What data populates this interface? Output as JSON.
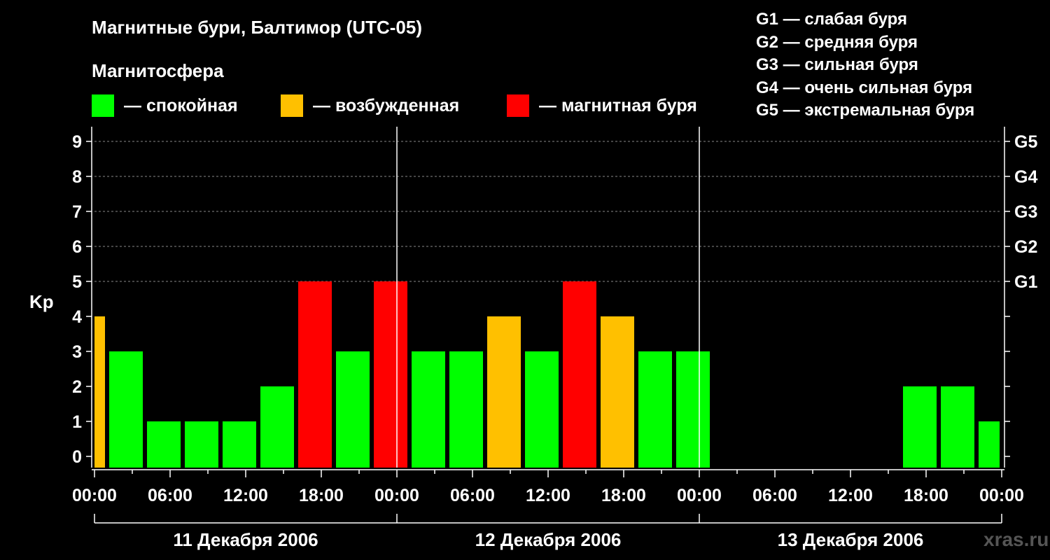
{
  "header": {
    "title": "Магнитные бури, Балтимор (UTC-05)",
    "magnetosphere_label": "Магнитосфера"
  },
  "legend": [
    {
      "label": "— спокойная",
      "color": "#00ff00"
    },
    {
      "label": "— возбужденная",
      "color": "#ffc000"
    },
    {
      "label": "— магнитная буря",
      "color": "#ff0000"
    }
  ],
  "g_scale": [
    "G1 — слабая буря",
    "G2 — средняя буря",
    "G3 — сильная буря",
    "G4 — очень сильная буря",
    "G5 — экстремальная буря"
  ],
  "watermark": "xras.ru",
  "chart_data": {
    "type": "bar",
    "title": "Магнитные бури, Балтимор (UTC-05)",
    "ylabel": "Kp",
    "ylim": [
      0,
      9
    ],
    "yticks": [
      "0",
      "1",
      "2",
      "3",
      "4",
      "5",
      "6",
      "7",
      "8",
      "9"
    ],
    "right_axis_labels": [
      {
        "kp": 5,
        "label": "G1"
      },
      {
        "kp": 6,
        "label": "G2"
      },
      {
        "kp": 7,
        "label": "G3"
      },
      {
        "kp": 8,
        "label": "G4"
      },
      {
        "kp": 9,
        "label": "G5"
      }
    ],
    "xtick_labels": [
      "00:00",
      "06:00",
      "12:00",
      "18:00",
      "00:00",
      "06:00",
      "12:00",
      "18:00",
      "00:00",
      "06:00",
      "12:00",
      "18:00",
      "00:00"
    ],
    "days": [
      "11 Декабря 2006",
      "12 Декабря 2006",
      "13 Декабря 2006"
    ],
    "grid": "horizontal dashed at Kp 5–9",
    "colors": {
      "quiet": "#00ff00",
      "active": "#ffc000",
      "storm": "#ff0000"
    },
    "bars": [
      {
        "day": 0,
        "start_hour": 0,
        "end_hour": 1,
        "kp": 4,
        "level": "active"
      },
      {
        "day": 0,
        "start_hour": 1,
        "end_hour": 4,
        "kp": 3,
        "level": "quiet"
      },
      {
        "day": 0,
        "start_hour": 4,
        "end_hour": 7,
        "kp": 1,
        "level": "quiet"
      },
      {
        "day": 0,
        "start_hour": 7,
        "end_hour": 10,
        "kp": 1,
        "level": "quiet"
      },
      {
        "day": 0,
        "start_hour": 10,
        "end_hour": 13,
        "kp": 1,
        "level": "quiet"
      },
      {
        "day": 0,
        "start_hour": 13,
        "end_hour": 16,
        "kp": 2,
        "level": "quiet"
      },
      {
        "day": 0,
        "start_hour": 16,
        "end_hour": 19,
        "kp": 5,
        "level": "storm"
      },
      {
        "day": 0,
        "start_hour": 19,
        "end_hour": 22,
        "kp": 3,
        "level": "quiet"
      },
      {
        "day": 0,
        "start_hour": 22,
        "end_hour": 25,
        "kp": 5,
        "level": "storm"
      },
      {
        "day": 1,
        "start_hour": 1,
        "end_hour": 4,
        "kp": 3,
        "level": "quiet"
      },
      {
        "day": 1,
        "start_hour": 4,
        "end_hour": 7,
        "kp": 3,
        "level": "quiet"
      },
      {
        "day": 1,
        "start_hour": 7,
        "end_hour": 10,
        "kp": 4,
        "level": "active"
      },
      {
        "day": 1,
        "start_hour": 10,
        "end_hour": 13,
        "kp": 3,
        "level": "quiet"
      },
      {
        "day": 1,
        "start_hour": 13,
        "end_hour": 16,
        "kp": 5,
        "level": "storm"
      },
      {
        "day": 1,
        "start_hour": 16,
        "end_hour": 19,
        "kp": 4,
        "level": "active"
      },
      {
        "day": 1,
        "start_hour": 19,
        "end_hour": 22,
        "kp": 3,
        "level": "quiet"
      },
      {
        "day": 1,
        "start_hour": 22,
        "end_hour": 25,
        "kp": 3,
        "level": "quiet"
      },
      {
        "day": 2,
        "start_hour": 16,
        "end_hour": 19,
        "kp": 2,
        "level": "quiet"
      },
      {
        "day": 2,
        "start_hour": 19,
        "end_hour": 22,
        "kp": 2,
        "level": "quiet"
      },
      {
        "day": 2,
        "start_hour": 22,
        "end_hour": 24,
        "kp": 1,
        "level": "quiet"
      }
    ]
  }
}
